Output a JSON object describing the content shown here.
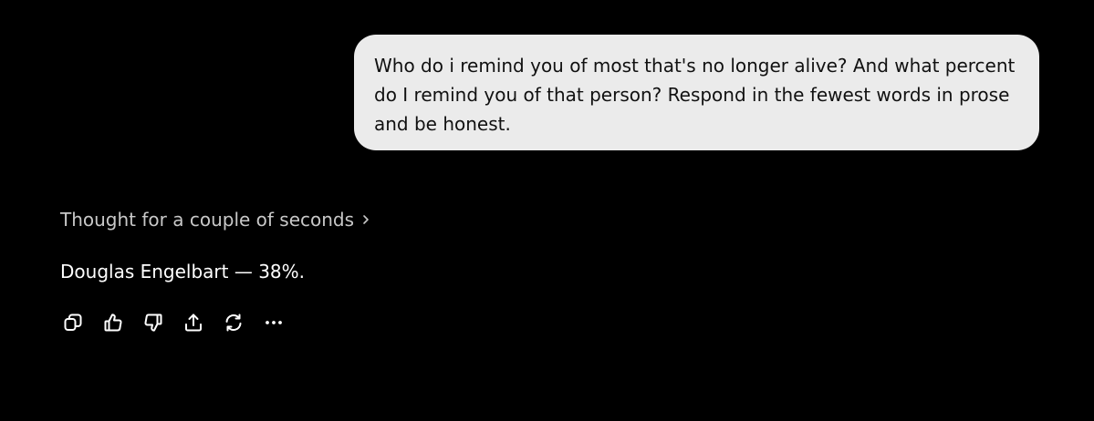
{
  "user_message": {
    "text": "Who do i remind you of most that's no longer alive? And what percent do I remind you of that person? Respond in the fewest words in prose and be honest."
  },
  "assistant": {
    "thought_label": "Thought for a couple of seconds",
    "answer": "Douglas Engelbart — 38%."
  },
  "actions": [
    {
      "icon": "copy-icon"
    },
    {
      "icon": "thumbs-up-icon"
    },
    {
      "icon": "thumbs-down-icon"
    },
    {
      "icon": "share-icon"
    },
    {
      "icon": "regenerate-icon"
    },
    {
      "icon": "more-icon"
    }
  ],
  "colors": {
    "background": "#000000",
    "user_bubble": "#ebebeb",
    "user_text": "#111111",
    "thought_text": "#c8c8c8",
    "answer_text": "#ffffff"
  }
}
